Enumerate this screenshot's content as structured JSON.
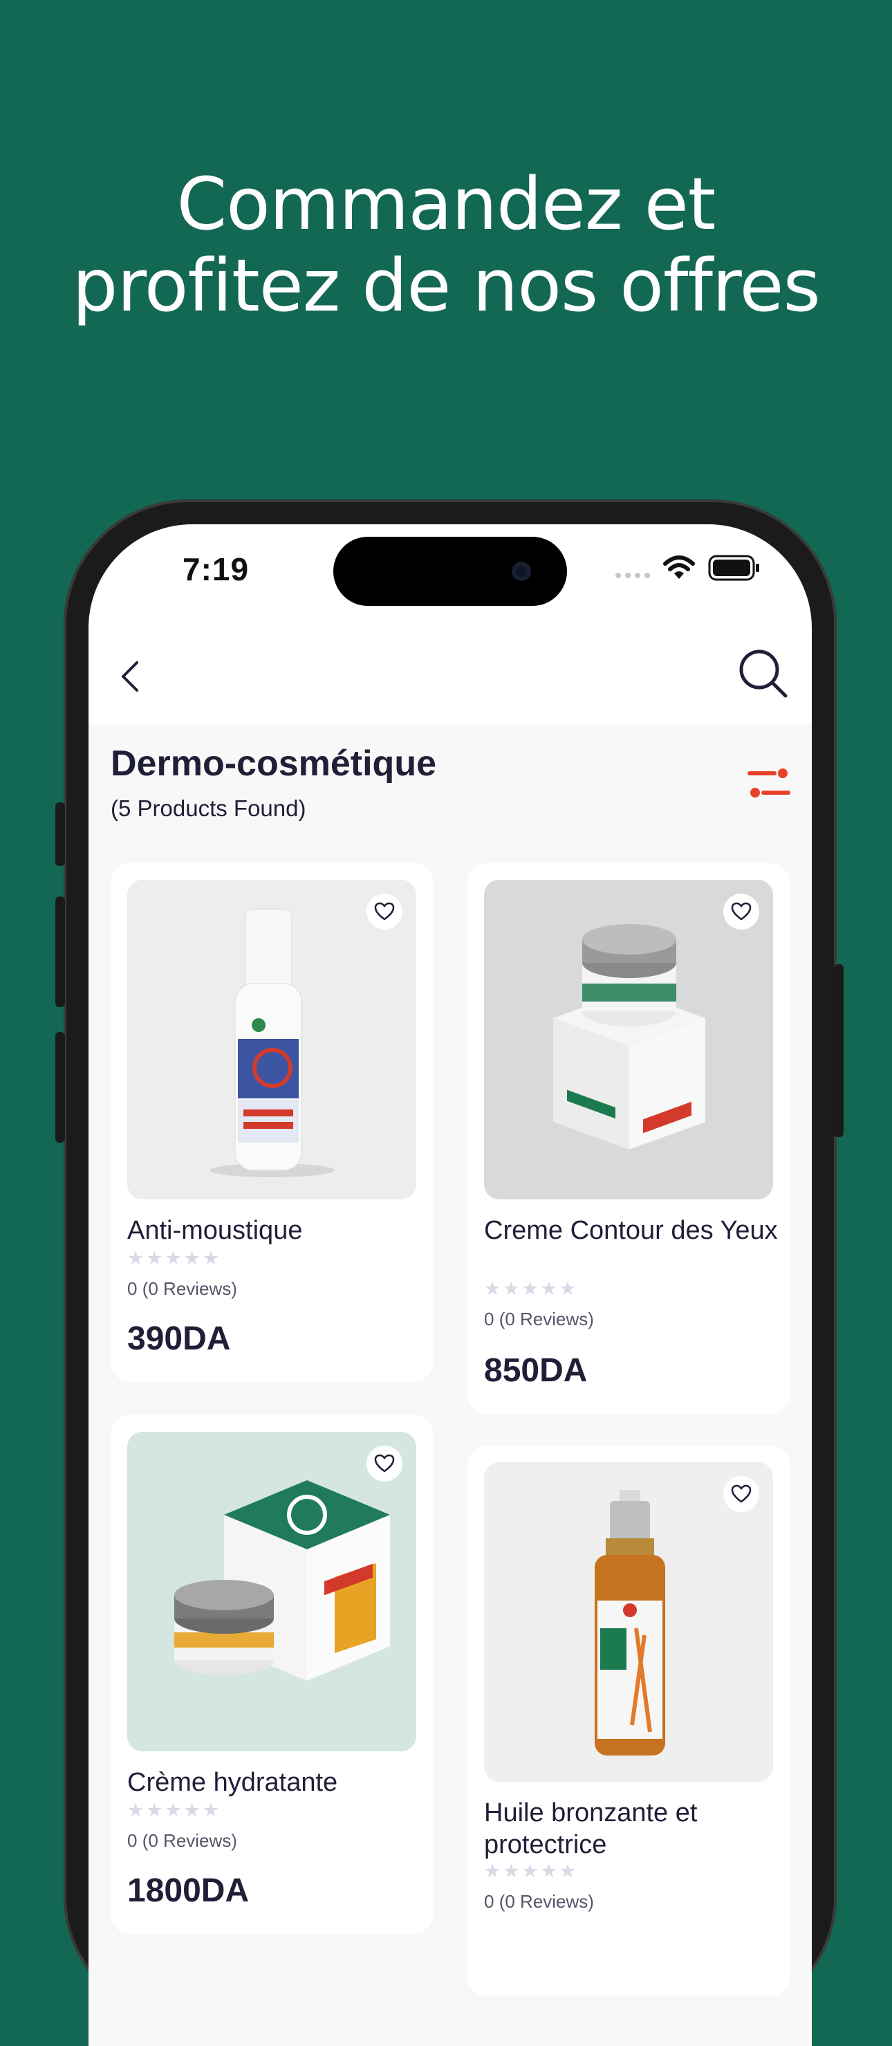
{
  "headline": {
    "line1": "Commandez et",
    "line2": "profitez de nos offres"
  },
  "status_bar": {
    "time": "7:19"
  },
  "category": {
    "title": "Dermo-cosmétique",
    "count": "(5 Products Found)"
  },
  "products": [
    {
      "name": "Anti-moustique",
      "rating": "0",
      "reviews": "(0 Reviews)",
      "price": "390DA",
      "image": "spray-bottle"
    },
    {
      "name": "Creme Contour des Yeux",
      "rating": "0",
      "reviews": "(0 Reviews)",
      "price": "850DA",
      "image": "cream-jar-box"
    },
    {
      "name": "Crème hydratante",
      "rating": "0",
      "reviews": "(0 Reviews)",
      "price": "1800DA",
      "image": "cream-jar-green-box"
    },
    {
      "name": "Huile bronzante et protectrice",
      "rating": "0",
      "reviews": "(0 Reviews)",
      "price": "",
      "image": "amber-oil-bottle"
    }
  ],
  "icons": {
    "back": "chevron-left-icon",
    "search": "search-icon",
    "filter": "filter-icon",
    "favorite": "heart-icon",
    "star": "star-icon"
  },
  "colors": {
    "background": "#136854",
    "accent": "#e8412a",
    "text": "#1f1f38"
  }
}
